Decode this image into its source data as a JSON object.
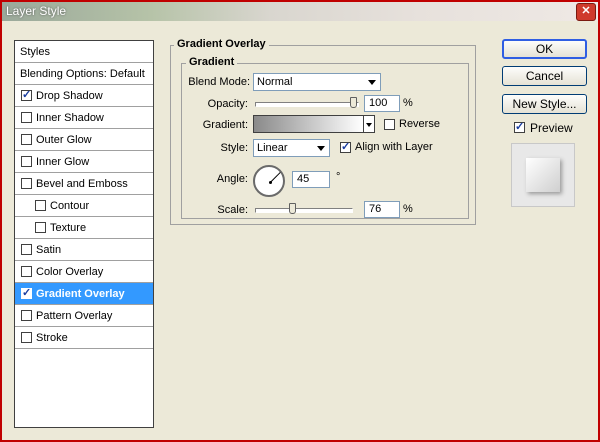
{
  "window": {
    "title": "Layer Style"
  },
  "styles_panel": {
    "header": "Styles",
    "blending_options": "Blending Options: Default",
    "items": [
      {
        "label": "Drop Shadow",
        "checked": true,
        "sub": false,
        "selected": false
      },
      {
        "label": "Inner Shadow",
        "checked": false,
        "sub": false,
        "selected": false
      },
      {
        "label": "Outer Glow",
        "checked": false,
        "sub": false,
        "selected": false
      },
      {
        "label": "Inner Glow",
        "checked": false,
        "sub": false,
        "selected": false
      },
      {
        "label": "Bevel and Emboss",
        "checked": false,
        "sub": false,
        "selected": false
      },
      {
        "label": "Contour",
        "checked": false,
        "sub": true,
        "selected": false
      },
      {
        "label": "Texture",
        "checked": false,
        "sub": true,
        "selected": false
      },
      {
        "label": "Satin",
        "checked": false,
        "sub": false,
        "selected": false
      },
      {
        "label": "Color Overlay",
        "checked": false,
        "sub": false,
        "selected": false
      },
      {
        "label": "Gradient Overlay",
        "checked": true,
        "sub": false,
        "selected": true
      },
      {
        "label": "Pattern Overlay",
        "checked": false,
        "sub": false,
        "selected": false
      },
      {
        "label": "Stroke",
        "checked": false,
        "sub": false,
        "selected": false
      }
    ]
  },
  "gradient_overlay": {
    "group_title": "Gradient Overlay",
    "subgroup_title": "Gradient",
    "blend_mode": {
      "label": "Blend Mode:",
      "value": "Normal"
    },
    "opacity": {
      "label": "Opacity:",
      "value": "100",
      "unit": "%",
      "percent": 100
    },
    "gradient": {
      "label": "Gradient:",
      "reverse_label": "Reverse",
      "reverse_checked": false
    },
    "style": {
      "label": "Style:",
      "value": "Linear",
      "align_label": "Align with Layer",
      "align_checked": true
    },
    "angle": {
      "label": "Angle:",
      "value": "45",
      "unit": "°"
    },
    "scale": {
      "label": "Scale:",
      "value": "76",
      "unit": "%",
      "percent": 76
    }
  },
  "buttons": {
    "ok": "OK",
    "cancel": "Cancel",
    "new_style": "New Style...",
    "preview_label": "Preview",
    "preview_checked": true
  },
  "colors": {
    "selection": "#3399ff",
    "window_bg": "#ece9d8",
    "frame_border": "#c00000"
  }
}
